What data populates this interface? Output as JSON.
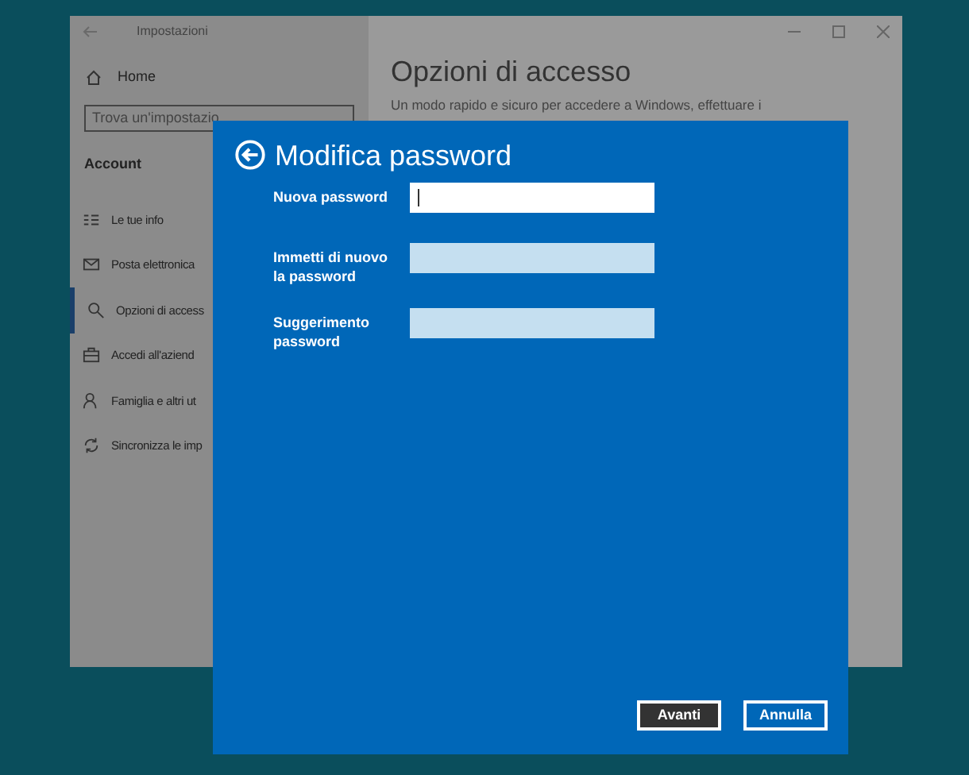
{
  "settings_window": {
    "title": "Impostazioni",
    "home": "Home",
    "search": {
      "placeholder": "Trova un'impostazio"
    },
    "section": "Account",
    "sidebar": {
      "items": [
        {
          "label": "Le tue info",
          "selected": false
        },
        {
          "label": "Posta elettronica",
          "selected": false
        },
        {
          "label": "Opzioni di access",
          "selected": true
        },
        {
          "label": "Accedi all'aziend",
          "selected": false
        },
        {
          "label": "Famiglia e altri ut",
          "selected": false
        },
        {
          "label": "Sincronizza le imp",
          "selected": false
        }
      ]
    },
    "page_title": "Opzioni di accesso",
    "page_description": "Un modo rapido e sicuro per accedere a Windows, effettuare i"
  },
  "dialog": {
    "title": "Modifica password",
    "fields": [
      {
        "label": "Nuova password",
        "focused": true
      },
      {
        "label": "Immetti di nuovo la password",
        "focused": false
      },
      {
        "label": "Suggerimento password",
        "focused": false
      }
    ],
    "buttons": [
      "Avanti",
      "Annulla"
    ]
  }
}
